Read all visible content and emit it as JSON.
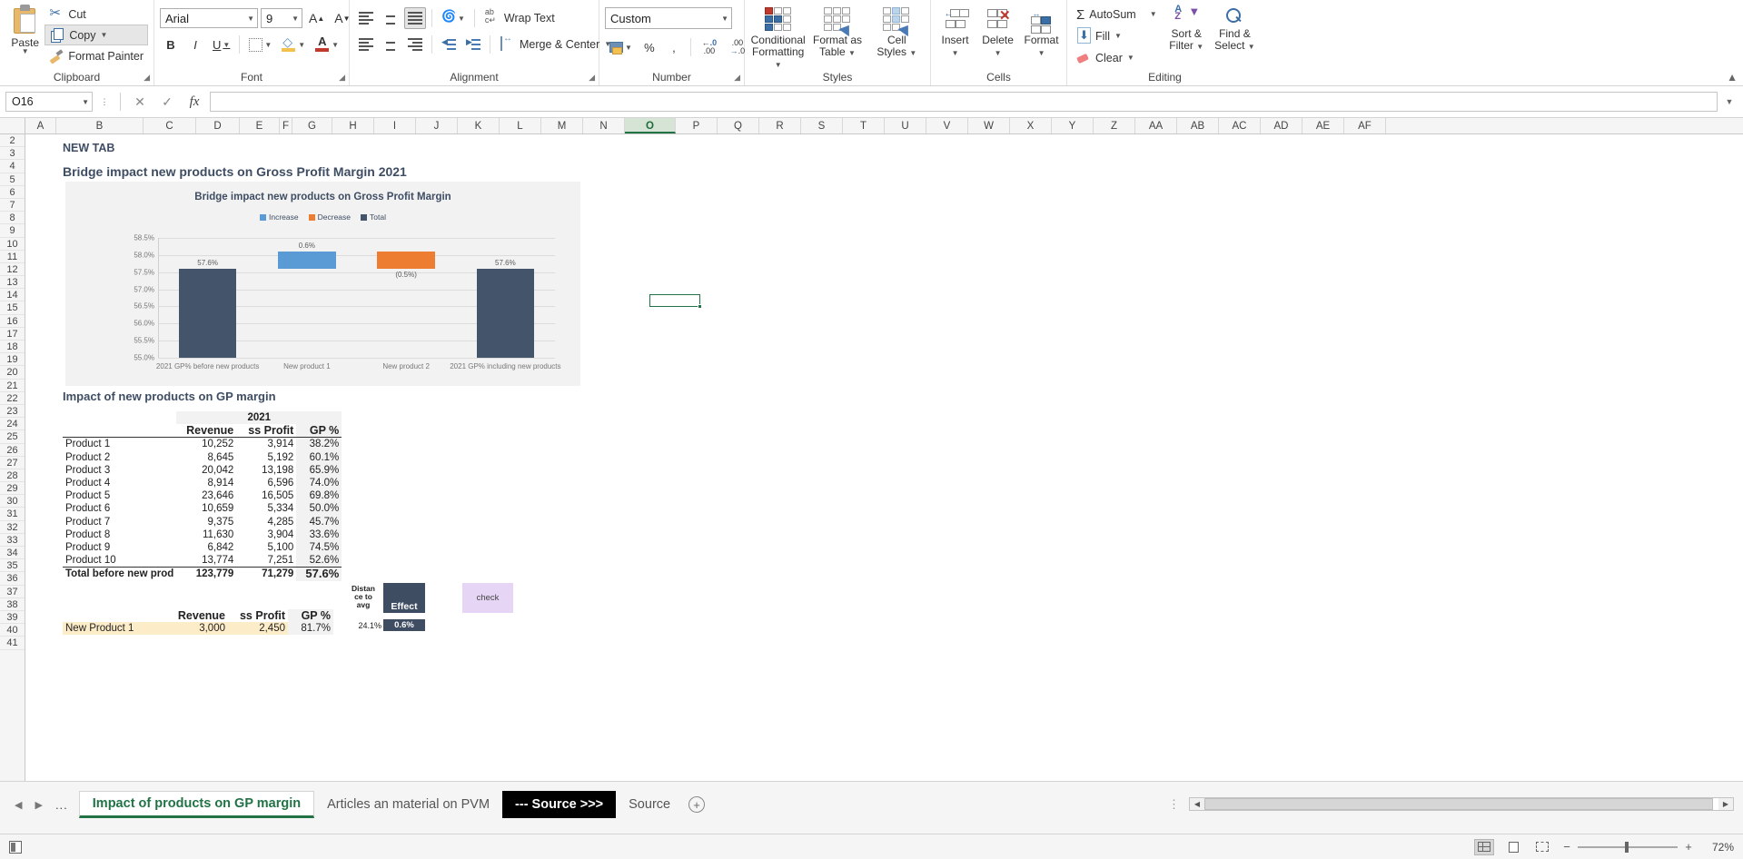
{
  "ribbon": {
    "clipboard": {
      "label": "Clipboard",
      "paste": "Paste",
      "cut": "Cut",
      "copy": "Copy",
      "format_painter": "Format Painter"
    },
    "font": {
      "label": "Font",
      "family": "Arial",
      "size": "9",
      "grow": "A",
      "shrink": "A",
      "bold": "B",
      "italic": "I",
      "underline": "U"
    },
    "alignment": {
      "label": "Alignment",
      "wrap_text": "Wrap Text",
      "merge_center": "Merge & Center"
    },
    "number": {
      "label": "Number",
      "format": "Custom",
      "percent": "%",
      "comma": ",",
      "inc_dec": ".00",
      "dec_dec": ".00"
    },
    "styles": {
      "label": "Styles",
      "conditional_formatting": "Conditional\nFormatting",
      "conditional_formatting_l1": "Conditional",
      "conditional_formatting_l2": "Formatting",
      "format_as_table_l1": "Format as",
      "format_as_table_l2": "Table",
      "cell_styles_l1": "Cell",
      "cell_styles_l2": "Styles"
    },
    "cells": {
      "label": "Cells",
      "insert": "Insert",
      "delete": "Delete",
      "format": "Format"
    },
    "editing": {
      "label": "Editing",
      "autosum": "AutoSum",
      "fill": "Fill",
      "clear": "Clear",
      "sort_filter_l1": "Sort &",
      "sort_filter_l2": "Filter",
      "find_select_l1": "Find &",
      "find_select_l2": "Select"
    }
  },
  "formula_bar": {
    "name_box": "O16",
    "cancel": "✕",
    "enter": "✓",
    "fx": "fx",
    "formula": ""
  },
  "grid": {
    "columns": [
      "A",
      "B",
      "C",
      "D",
      "E",
      "F",
      "G",
      "H",
      "I",
      "J",
      "K",
      "L",
      "M",
      "N",
      "O",
      "P",
      "Q",
      "R",
      "S",
      "T",
      "U",
      "V",
      "W",
      "X",
      "Y",
      "Z",
      "AA",
      "AB",
      "AC",
      "AD",
      "AE",
      "AF"
    ],
    "active_column": "O",
    "rows": [
      "2",
      "3",
      "4",
      "5",
      "6",
      "7",
      "8",
      "9",
      "10",
      "11",
      "12",
      "13",
      "14",
      "15",
      "16",
      "17",
      "18",
      "19",
      "20",
      "21",
      "22",
      "23",
      "24",
      "25",
      "26",
      "27",
      "28",
      "29",
      "30",
      "31",
      "32",
      "33",
      "34",
      "35",
      "36",
      "37",
      "38",
      "39",
      "40",
      "41"
    ],
    "active_cell": "O16"
  },
  "sheet_content": {
    "new_tab_label": "NEW TAB",
    "heading_1": "Bridge impact new products on Gross Profit Margin 2021",
    "heading_2": "Impact of new products on GP margin"
  },
  "chart_data": {
    "type": "bar",
    "title": "Bridge impact new products on Gross Profit Margin",
    "xlabel": "",
    "ylabel": "",
    "ylim": [
      55.0,
      58.5
    ],
    "ytick_labels": [
      "58.5%",
      "58.0%",
      "57.5%",
      "57.0%",
      "56.5%",
      "56.0%",
      "55.5%",
      "55.0%"
    ],
    "yticks": [
      58.5,
      58.0,
      57.5,
      57.0,
      56.5,
      56.0,
      55.5,
      55.0
    ],
    "grid": true,
    "legend_position": "top",
    "legend": [
      {
        "name": "Increase",
        "color": "#5b9bd5"
      },
      {
        "name": "Decrease",
        "color": "#ed7d31"
      },
      {
        "name": "Total",
        "color": "#44546a"
      }
    ],
    "categories": [
      "2021 GP% before new products",
      "New product 1",
      "New product 2",
      "2021 GP% including new products"
    ],
    "bars": [
      {
        "category": "2021 GP% before new products",
        "series": "Total",
        "base": 55.0,
        "top": 57.6,
        "label": "57.6%",
        "color": "#44546a"
      },
      {
        "category": "New product 1",
        "series": "Increase",
        "base": 57.6,
        "top": 58.1,
        "label": "0.6%",
        "color": "#5b9bd5"
      },
      {
        "category": "New product 2",
        "series": "Decrease",
        "base": 57.6,
        "top": 58.1,
        "label": "(0.5%)",
        "color": "#ed7d31"
      },
      {
        "category": "2021 GP% including new products",
        "series": "Total",
        "base": 55.0,
        "top": 57.6,
        "label": "57.6%",
        "color": "#44546a"
      }
    ]
  },
  "table_main": {
    "year_header": "2021",
    "columns": [
      "",
      "Revenue",
      "Gross Profit",
      "GP %"
    ],
    "col_revenue": "Revenue",
    "col_profit": "ss Profit",
    "col_gp": "GP %",
    "rows": [
      {
        "name": "Product 1",
        "revenue": "10,252",
        "profit": "3,914",
        "gp": "38.2%"
      },
      {
        "name": "Product 2",
        "revenue": "8,645",
        "profit": "5,192",
        "gp": "60.1%"
      },
      {
        "name": "Product 3",
        "revenue": "20,042",
        "profit": "13,198",
        "gp": "65.9%"
      },
      {
        "name": "Product 4",
        "revenue": "8,914",
        "profit": "6,596",
        "gp": "74.0%"
      },
      {
        "name": "Product 5",
        "revenue": "23,646",
        "profit": "16,505",
        "gp": "69.8%"
      },
      {
        "name": "Product 6",
        "revenue": "10,659",
        "profit": "5,334",
        "gp": "50.0%"
      },
      {
        "name": "Product 7",
        "revenue": "9,375",
        "profit": "4,285",
        "gp": "45.7%"
      },
      {
        "name": "Product 8",
        "revenue": "11,630",
        "profit": "3,904",
        "gp": "33.6%"
      },
      {
        "name": "Product 9",
        "revenue": "6,842",
        "profit": "5,100",
        "gp": "74.5%"
      },
      {
        "name": "Product 10",
        "revenue": "13,774",
        "profit": "7,251",
        "gp": "52.6%"
      }
    ],
    "total": {
      "name": "Total before new prod",
      "revenue": "123,779",
      "profit": "71,279",
      "gp": "57.6%"
    }
  },
  "table_new": {
    "col_revenue": "Revenue",
    "col_profit": "ss Profit",
    "col_gp": "GP %",
    "col_distance_l1": "Distan",
    "col_distance_l2": "ce to",
    "col_distance_l3": "avg",
    "col_effect": "Effect",
    "check_label": "check",
    "rows": [
      {
        "name": "New Product 1",
        "revenue": "3,000",
        "profit": "2,450",
        "gp": "81.7%",
        "distance": "24.1%",
        "effect": "0.6%"
      }
    ]
  },
  "sheet_tabs": {
    "prev": "◀",
    "next": "▶",
    "more": "...",
    "items": [
      {
        "label": "Impact of products on GP margin",
        "state": "active"
      },
      {
        "label": "Articles an material on PVM",
        "state": "normal"
      },
      {
        "label": "--- Source >>>",
        "state": "black"
      },
      {
        "label": "Source",
        "state": "normal"
      }
    ],
    "add_sheet": "+"
  },
  "status_bar": {
    "macro_label": "macro-record",
    "views": [
      "normal-view",
      "page-layout-view",
      "page-break-view"
    ],
    "active_view": "normal-view",
    "zoom_out": "−",
    "zoom_in": "+",
    "zoom_level": "72%"
  },
  "colors": {
    "accent_green": "#217346",
    "increase": "#5b9bd5",
    "decrease": "#ed7d31",
    "total": "#44546a",
    "heading": "#3f4d63",
    "chart_bg": "#f2f2f2"
  }
}
